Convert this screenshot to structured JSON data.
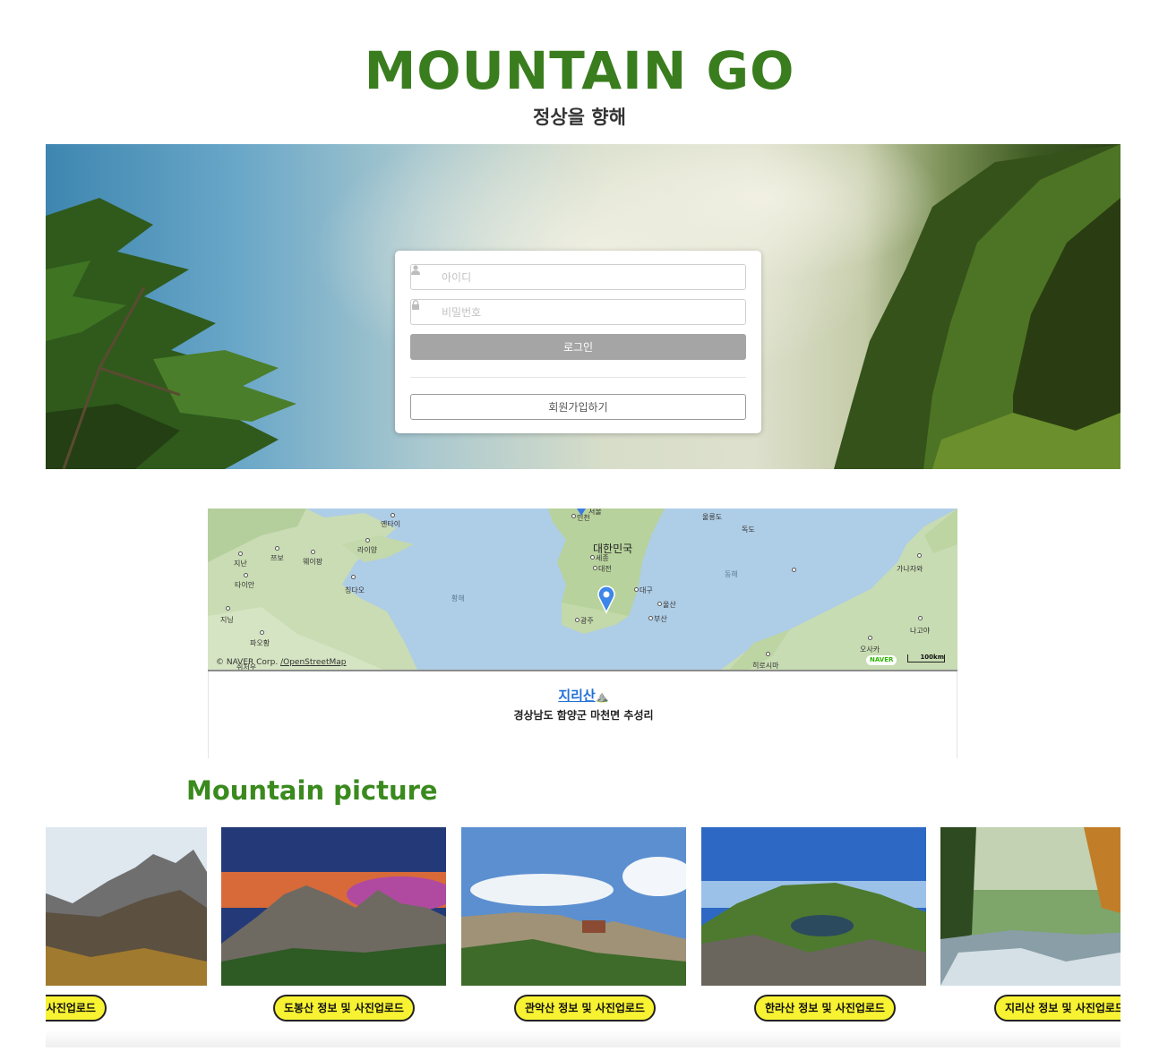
{
  "header": {
    "title": "MOUNTAIN GO",
    "subtitle": "정상을 향해"
  },
  "login": {
    "id_placeholder": "아이디",
    "pw_placeholder": "비밀번호",
    "login_label": "로그인",
    "signup_label": "회원가입하기",
    "id_icon": "user-icon",
    "pw_icon": "lock-icon"
  },
  "map": {
    "labels": {
      "yantai": "옌타이",
      "jinan": "지난",
      "zibo": "쯔보",
      "weifang": "웨이팡",
      "laiyang": "라이양",
      "taian": "타이안",
      "qingdao": "칭다오",
      "jining": "지닝",
      "yellow_sea": "황해",
      "xuzhou": "쉬저우",
      "seoul": "서울",
      "incheon": "인천",
      "korea": "대한민국",
      "sejong": "세종",
      "daejeon": "대전",
      "daegu": "대구",
      "ulsan": "울산",
      "busan": "부산",
      "gwangju": "광주",
      "ulleungdo": "울릉도",
      "dokdo": "독도",
      "east_sea": "동해",
      "kanazawa": "가나자와",
      "nagoya": "나고야",
      "osaka": "오사카",
      "hiroshima": "히로시마",
      "paojiang": "파오황"
    },
    "copyright": "© NAVER Corp.",
    "osm": "/OpenStreetMap",
    "brand": "NAVER",
    "scale": "100km"
  },
  "selected_mountain": {
    "name": "지리산",
    "emoji": "⛰️",
    "address": "경상남도 함양군 마천면 추성리"
  },
  "gallery": {
    "title": "Mountain picture",
    "cards": [
      {
        "label": "설악산 정보 및 사진업로드"
      },
      {
        "label": "도봉산 정보 및 사진업로드"
      },
      {
        "label": "관악산 정보 및 사진업로드"
      },
      {
        "label": "한라산 정보 및 사진업로드"
      },
      {
        "label": "지리산 정보 및 사진업로드"
      }
    ]
  },
  "colors": {
    "brand_green": "#3a7d1e",
    "button_yellow": "#f7f232",
    "link_blue": "#1f6fd6",
    "login_gray": "#a5a5a5"
  }
}
